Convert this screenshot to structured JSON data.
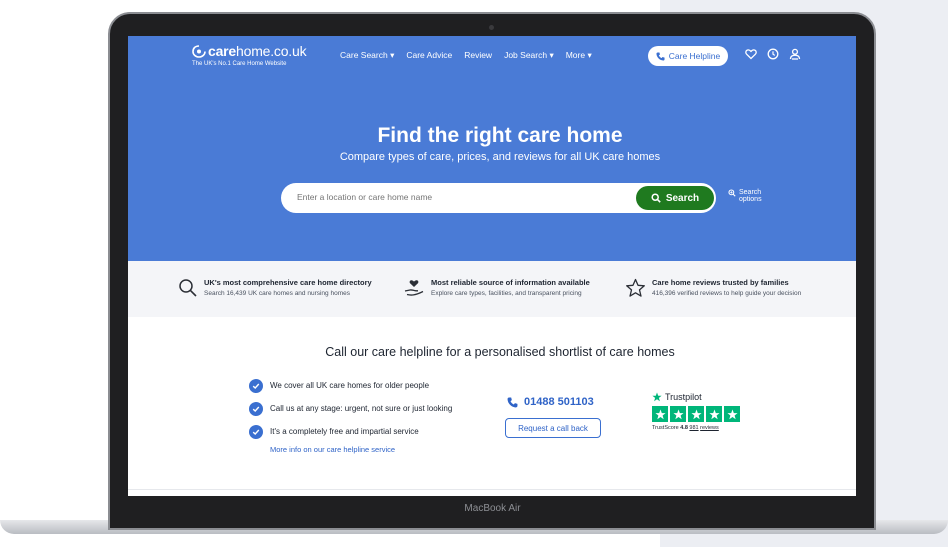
{
  "device": {
    "label": "MacBook Air"
  },
  "header": {
    "logo_bold": "care",
    "logo_light": "home.co.uk",
    "tagline": "The UK's No.1 Care Home Website",
    "nav": [
      {
        "label": "Care Search ▾"
      },
      {
        "label": "Care Advice"
      },
      {
        "label": "Review"
      },
      {
        "label": "Job Search ▾"
      },
      {
        "label": "More ▾"
      }
    ],
    "helpline_label": "Care Helpline",
    "icons": [
      "heart-icon",
      "clock-icon",
      "user-icon"
    ]
  },
  "hero": {
    "title": "Find the right care home",
    "subtitle": "Compare types of care, prices, and reviews for all UK care homes",
    "search_placeholder": "Enter a location or care home name",
    "search_button": "Search",
    "search_options": "Search options"
  },
  "features": [
    {
      "icon": "search-icon",
      "title": "UK's most comprehensive care home directory",
      "desc": "Search 16,439 UK care homes and nursing homes"
    },
    {
      "icon": "heart-hand-icon",
      "title": "Most reliable source of information available",
      "desc": "Explore care types, facilities, and transparent pricing"
    },
    {
      "icon": "star-icon",
      "title": "Care home reviews trusted by families",
      "desc": "416,396 verified reviews to help guide your decision"
    }
  ],
  "helpline": {
    "title": "Call our care helpline for a personalised shortlist of care homes",
    "checks": [
      "We cover all UK care homes for older people",
      "Call us at any stage: urgent, not sure or just looking",
      "It's a completely free and impartial service"
    ],
    "more_link": "More info on our care helpline service",
    "phone": "01488 501103",
    "callback": "Request a call back"
  },
  "trustpilot": {
    "brand": "Trustpilot",
    "score_label": "TrustScore",
    "score": "4.8",
    "reviews_count": "981",
    "reviews_label": "reviews",
    "stars": 5
  },
  "colors": {
    "primary": "#4a7bd6",
    "search_button": "#1f7a1f",
    "trustpilot": "#00b67a",
    "link": "#2f63c7"
  }
}
